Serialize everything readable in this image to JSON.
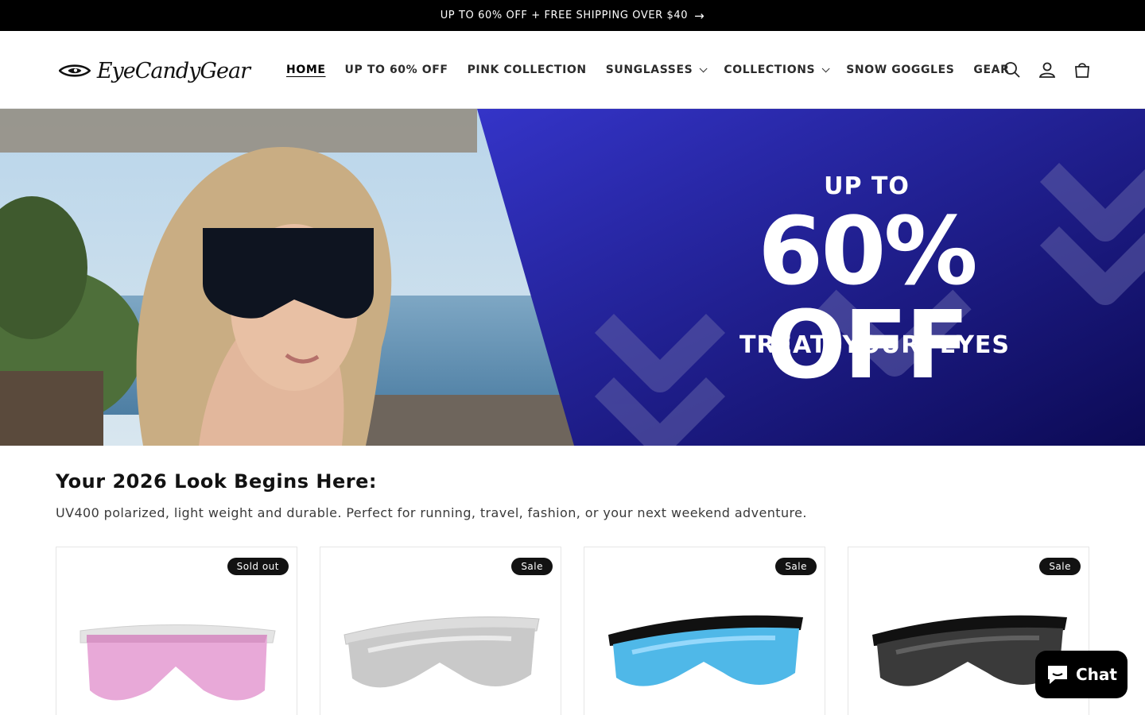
{
  "announcement": {
    "text": "UP TO 60% OFF + FREE SHIPPING OVER $40",
    "arrow": "→"
  },
  "header": {
    "logo_text": "EyeCandyGear",
    "nav": [
      {
        "label": "HOME",
        "active": true
      },
      {
        "label": "UP TO 60% OFF"
      },
      {
        "label": "PINK COLLECTION"
      },
      {
        "label": "SUNGLASSES",
        "dropdown": true
      },
      {
        "label": "COLLECTIONS",
        "dropdown": true
      },
      {
        "label": "SNOW GOGGLES"
      },
      {
        "label": "GEAR"
      }
    ],
    "icons": [
      "search-icon",
      "account-icon",
      "cart-icon"
    ]
  },
  "hero": {
    "line1": "UP TO",
    "line2": "60% OFF",
    "line3": "TREAT. YOUR. EYES"
  },
  "intro": {
    "title": "Your 2026 Look Begins Here:",
    "text": "UV400 polarized, light weight and durable. Perfect for running, travel, fashion, or your next weekend adventure."
  },
  "products": [
    {
      "badge": "Sold out",
      "lens_color": "#e8a9d8"
    },
    {
      "badge": "Sale",
      "lens_color": "#c9c9c9"
    },
    {
      "badge": "Sale",
      "lens_color": "#4fb8e8"
    },
    {
      "badge": "Sale",
      "lens_color": "#3a3a3a"
    }
  ],
  "chat": {
    "label": "Chat"
  },
  "colors": {
    "hero_blue": "#1c1a7a",
    "black": "#000000"
  }
}
